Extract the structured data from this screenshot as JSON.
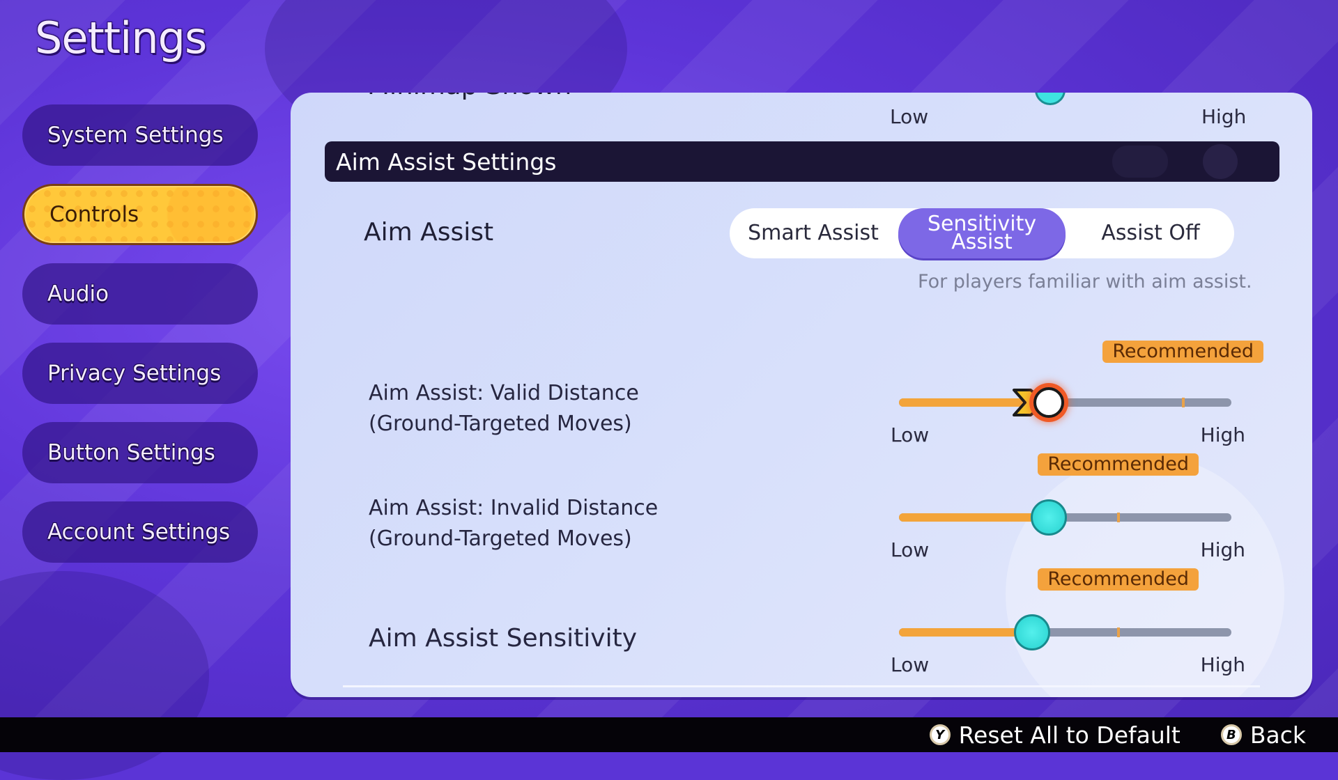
{
  "page": {
    "title": "Settings"
  },
  "nav": {
    "items": [
      {
        "label": "System Settings",
        "active": false
      },
      {
        "label": "Controls",
        "active": true
      },
      {
        "label": "Audio",
        "active": false
      },
      {
        "label": "Privacy Settings",
        "active": false
      },
      {
        "label": "Button Settings",
        "active": false
      },
      {
        "label": "Account Settings",
        "active": false
      }
    ]
  },
  "panel": {
    "cut_off_row": {
      "label": "Minimap Shown",
      "low_label": "Low",
      "high_label": "High"
    },
    "section_title": "Aim Assist Settings",
    "aim_assist": {
      "label": "Aim Assist",
      "options": [
        "Smart Assist",
        "Sensitivity\nAssist",
        "Assist Off"
      ],
      "option_line1": [
        "Smart Assist",
        "Sensitivity",
        "Assist Off"
      ],
      "option_line2": [
        "",
        "Assist",
        ""
      ],
      "selected_index": 1,
      "description": "For players familiar with aim assist."
    },
    "sliders": [
      {
        "label_line1": "Aim Assist: Valid Distance",
        "label_line2": "(Ground-Targeted Moves)",
        "value": 0.45,
        "recommended": 0.855,
        "recommended_label": "Recommended",
        "low_label": "Low",
        "high_label": "High",
        "focused": true
      },
      {
        "label_line1": "Aim Assist: Invalid Distance",
        "label_line2": "(Ground-Targeted Moves)",
        "value": 0.45,
        "recommended": 0.66,
        "recommended_label": "Recommended",
        "low_label": "Low",
        "high_label": "High",
        "focused": false
      },
      {
        "label_line1": "Aim Assist Sensitivity",
        "label_line2": "",
        "value": 0.4,
        "recommended": 0.66,
        "recommended_label": "Recommended",
        "low_label": "Low",
        "high_label": "High",
        "focused": false
      }
    ]
  },
  "footer": {
    "hints": [
      {
        "button": "Y",
        "label": "Reset All to Default"
      },
      {
        "button": "B",
        "label": "Back"
      }
    ]
  },
  "colors": {
    "background": "#5b34d6",
    "active_nav": "#ffc83a",
    "segment_selected": "#7d68e6",
    "slider_fill": "#f3a43a",
    "slider_knob": "#35dbd8",
    "recommended_badge": "#f4a23c",
    "focus_ring": "#f05a26"
  }
}
